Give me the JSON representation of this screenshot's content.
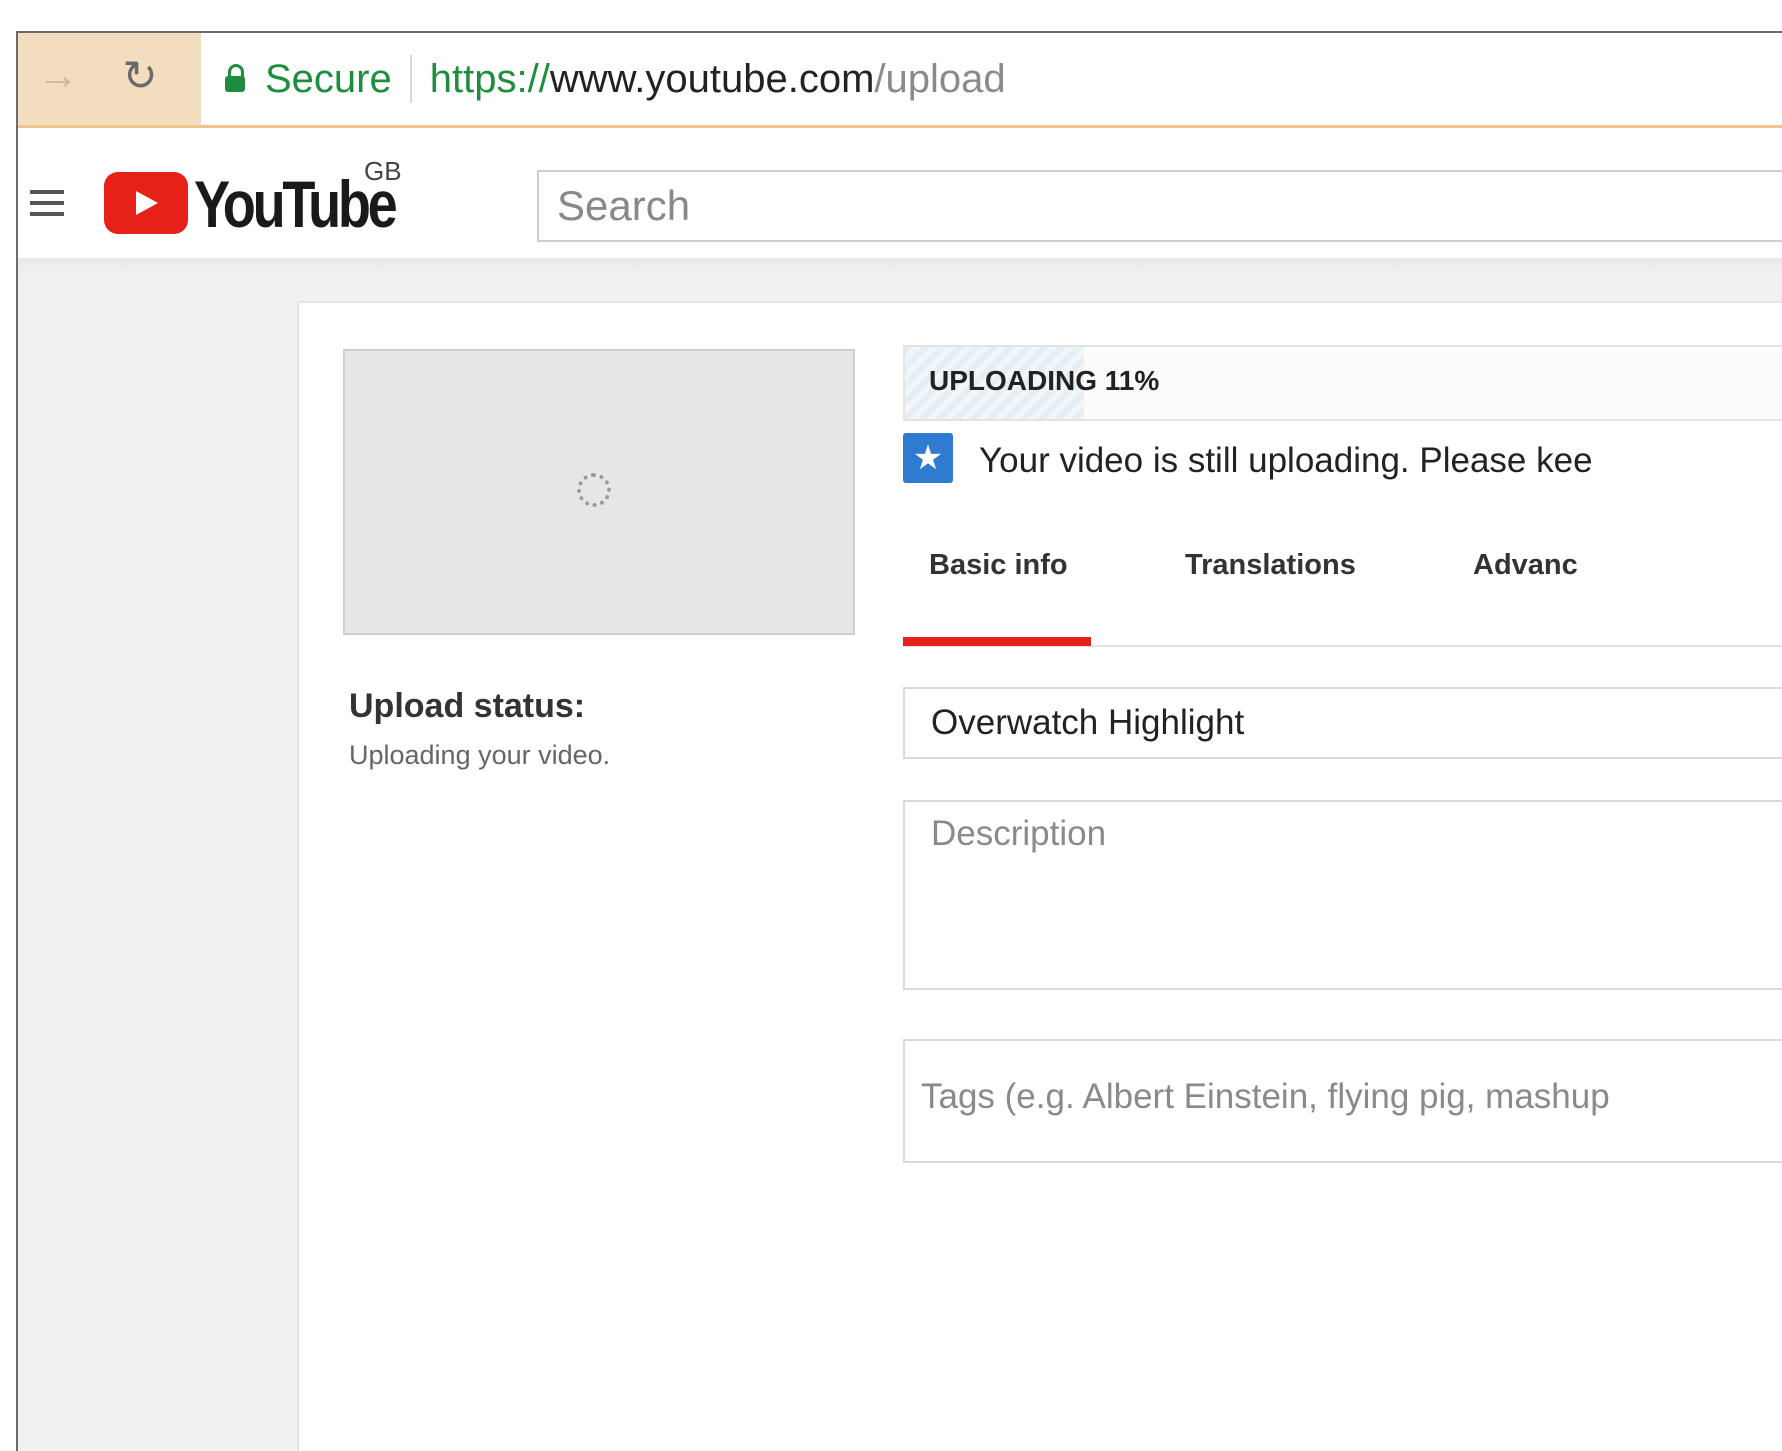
{
  "browser": {
    "back_icon": "arrow-right-icon",
    "reload_icon": "reload-icon",
    "secure_label": "Secure",
    "url": {
      "scheme": "https://",
      "host": "www.youtube.com",
      "path": "/upload"
    }
  },
  "header": {
    "logo_text": "YouTube",
    "region": "GB",
    "search_placeholder": "Search"
  },
  "upload": {
    "progress_label": "UPLOADING 11%",
    "progress_fraction": 0.11,
    "notice": "Your video is still uploading. Please kee",
    "status_label": "Upload status:",
    "status_text": "Uploading your video."
  },
  "tabs": [
    {
      "label": "Basic info",
      "active": true
    },
    {
      "label": "Translations",
      "active": false
    },
    {
      "label": "Advanc",
      "active": false
    }
  ],
  "form": {
    "title_value": "Overwatch Highlight",
    "description_placeholder": "Description",
    "tags_placeholder": "Tags (e.g. Albert Einstein, flying pig, mashup"
  },
  "colors": {
    "accent_red": "#e62117",
    "secure_green": "#1e8e3e",
    "info_blue": "#2f7bd1"
  }
}
